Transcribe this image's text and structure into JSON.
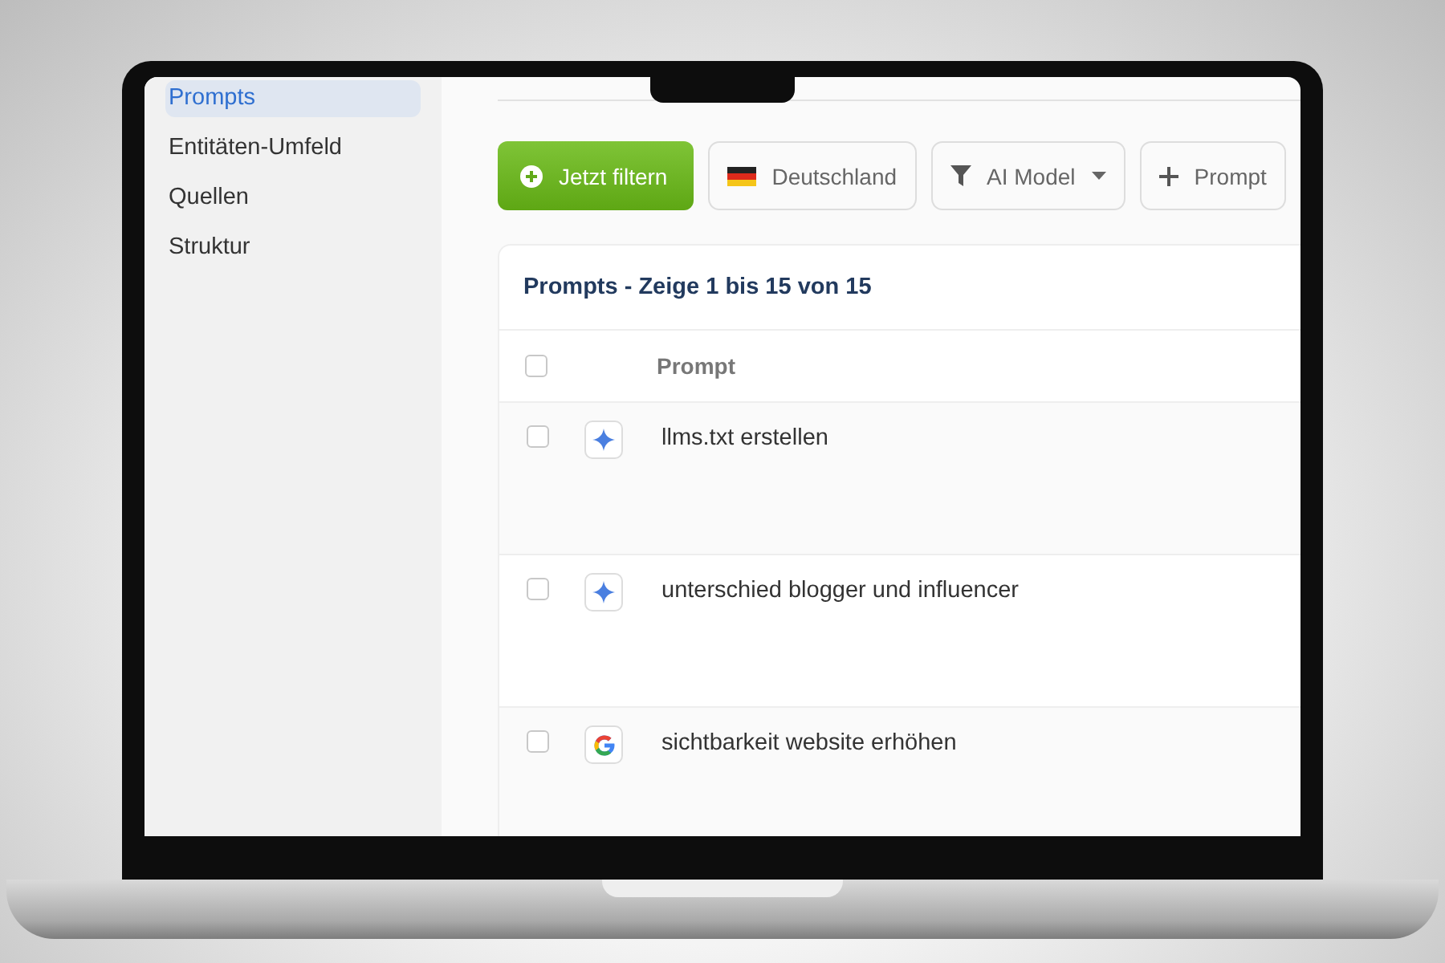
{
  "sidebar": {
    "items": [
      {
        "label": "Prompts",
        "selected": true
      },
      {
        "label": "Entitäten-Umfeld",
        "selected": false
      },
      {
        "label": "Quellen",
        "selected": false
      },
      {
        "label": "Struktur",
        "selected": false
      }
    ]
  },
  "toolbar": {
    "filter_button": "Jetzt filtern",
    "country": "Deutschland",
    "model_dropdown": "AI Model",
    "add_button": "Prompt"
  },
  "table": {
    "title": "Prompts - Zeige 1 bis 15 von 15",
    "header_checked": false,
    "columns": [
      "Prompt"
    ],
    "rows": [
      {
        "kind": "gemini",
        "prompt": "llms.txt erstellen",
        "checked": false
      },
      {
        "kind": "gemini",
        "prompt": "unterschied blogger und influencer",
        "checked": false
      },
      {
        "kind": "google",
        "prompt": "sichtbarkeit website erhöhen",
        "checked": false
      }
    ]
  }
}
